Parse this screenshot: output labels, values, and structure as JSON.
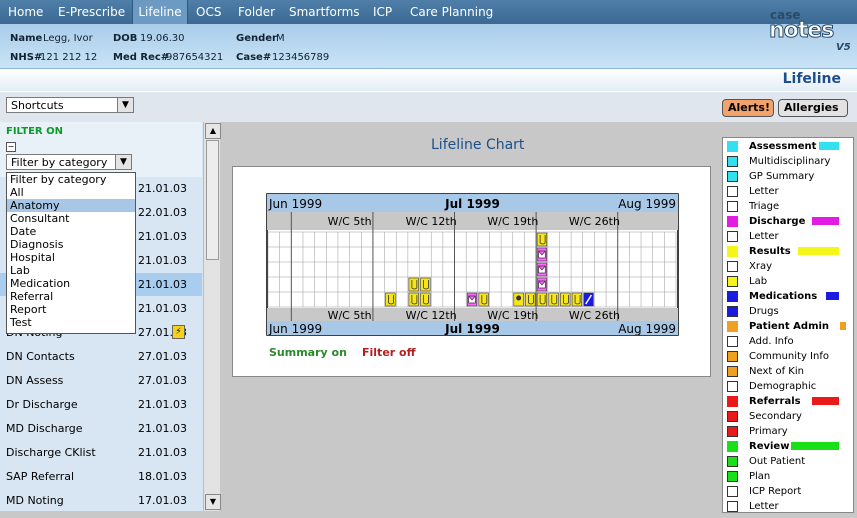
{
  "menu": {
    "items": [
      {
        "label": "Home",
        "active": false
      },
      {
        "label": "E-Prescribe",
        "active": false
      },
      {
        "label": "Lifeline",
        "active": true
      },
      {
        "label": "OCS",
        "active": false
      },
      {
        "label": "Folder",
        "active": false
      },
      {
        "label": "Smartforms",
        "active": false
      },
      {
        "label": "ICP",
        "active": false
      },
      {
        "label": "Care Planning",
        "active": false
      }
    ]
  },
  "patient": {
    "name_label": "Name",
    "name": "Legg, Ivor",
    "dob_label": "DOB",
    "dob": "19.06.30",
    "gender_label": "Gender",
    "gender": "M",
    "nhs_label": "NHS#",
    "nhs": "121 212 12",
    "medrec_label": "Med Rec#",
    "medrec": "987654321",
    "case_label": "Case#",
    "case": "123456789"
  },
  "logo": {
    "top": "case",
    "bottom": "notes",
    "version": "V5"
  },
  "page_title": "Lifeline",
  "toolbar": {
    "shortcuts_value": "Shortcuts",
    "alerts_label": "Alerts!",
    "allergies_label": "Allergies"
  },
  "sidebar": {
    "filter_on_label": "FILTER ON",
    "collapse_glyph": "−",
    "filter_select_value": "Filter by category",
    "dropdown_options": [
      "Filter by category",
      "All",
      "Anatomy",
      "Consultant",
      "Date",
      "Diagnosis",
      "Hospital",
      "Lab",
      "Medication",
      "Referral",
      "Report",
      "Test"
    ],
    "selected_option": "Anatomy",
    "items": [
      {
        "label": "",
        "date": "21.01.03"
      },
      {
        "label": "",
        "date": "22.01.03"
      },
      {
        "label": "",
        "date": "21.01.03"
      },
      {
        "label": "",
        "date": "21.01.03"
      },
      {
        "label": "",
        "date": "21.01.03"
      },
      {
        "label": "",
        "date": "21.01.03"
      },
      {
        "label": "DN Noting",
        "date": "27.01.03"
      },
      {
        "label": "DN Contacts",
        "date": "27.01.03"
      },
      {
        "label": "DN Assess",
        "date": "27.01.03"
      },
      {
        "label": "Dr Discharge",
        "date": "21.01.03"
      },
      {
        "label": "MD Discharge",
        "date": "21.01.03"
      },
      {
        "label": "Discharge CKlist",
        "date": "21.01.03"
      },
      {
        "label": "SAP Referral",
        "date": "18.01.03"
      },
      {
        "label": "MD Noting",
        "date": "17.01.03"
      }
    ]
  },
  "chart": {
    "title": "Lifeline Chart",
    "months": [
      "Jun 1999",
      "Jul 1999",
      "Aug 1999"
    ],
    "weeks": [
      "W/C 5th",
      "W/C 12th",
      "W/C 19th",
      "W/C 26th"
    ],
    "summary_label": "Summary on",
    "filter_label": "Filter off"
  },
  "colors": {
    "summary": "#2a8a2a",
    "filter": "#b02020",
    "accent": "#1d4f8c",
    "alerts_bg": "#f2a36a"
  },
  "chart_data": {
    "type": "table",
    "events": [
      {
        "day": 10,
        "row": 4,
        "icon": "lab-icon"
      },
      {
        "day": 12,
        "row": 3,
        "icon": "lab-icon"
      },
      {
        "day": 12,
        "row": 4,
        "icon": "lab-icon"
      },
      {
        "day": 13,
        "row": 3,
        "icon": "lab-icon"
      },
      {
        "day": 13,
        "row": 4,
        "icon": "lab-icon"
      },
      {
        "day": 17,
        "row": 4,
        "icon": "letter-icon"
      },
      {
        "day": 18,
        "row": 4,
        "icon": "lab-icon"
      },
      {
        "day": 21,
        "row": 4,
        "icon": "xray-icon"
      },
      {
        "day": 22,
        "row": 4,
        "icon": "lab-icon"
      },
      {
        "day": 23,
        "row": 0,
        "icon": "lab-icon"
      },
      {
        "day": 23,
        "row": 1,
        "icon": "letter-icon"
      },
      {
        "day": 23,
        "row": 2,
        "icon": "letter-icon"
      },
      {
        "day": 23,
        "row": 3,
        "icon": "letter-icon"
      },
      {
        "day": 23,
        "row": 4,
        "icon": "lab-icon"
      },
      {
        "day": 24,
        "row": 4,
        "icon": "lab-icon"
      },
      {
        "day": 25,
        "row": 4,
        "icon": "lab-icon"
      },
      {
        "day": 26,
        "row": 4,
        "icon": "lab-icon"
      },
      {
        "day": 27,
        "row": 4,
        "icon": "drugs-icon"
      }
    ]
  },
  "legend": [
    {
      "kind": "head",
      "label": "Assessment",
      "color": "#33e0f0"
    },
    {
      "kind": "item",
      "label": "Multidisciplinary",
      "icon": "md-icon"
    },
    {
      "kind": "item",
      "label": "GP Summary",
      "icon": "gp-icon"
    },
    {
      "kind": "item",
      "label": "Letter",
      "icon": "letter-icon"
    },
    {
      "kind": "item",
      "label": "Triage",
      "icon": "triage-icon"
    },
    {
      "kind": "head",
      "label": "Discharge",
      "color": "#e31ce3"
    },
    {
      "kind": "item",
      "label": "Letter",
      "icon": "letter-icon"
    },
    {
      "kind": "head",
      "label": "Results",
      "color": "#f5f51a"
    },
    {
      "kind": "item",
      "label": "Xray",
      "icon": "xray-icon"
    },
    {
      "kind": "item",
      "label": "Lab",
      "icon": "lab-icon"
    },
    {
      "kind": "head",
      "label": "Medications",
      "color": "#1a1ae0"
    },
    {
      "kind": "item",
      "label": "Drugs",
      "icon": "drugs-icon"
    },
    {
      "kind": "head",
      "label": "Patient Admin",
      "color": "#f0a020"
    },
    {
      "kind": "item",
      "label": "Add. Info",
      "icon": "addinfo-icon"
    },
    {
      "kind": "item",
      "label": "Community Info",
      "icon": "community-icon"
    },
    {
      "kind": "item",
      "label": "Next of Kin",
      "icon": "nok-icon"
    },
    {
      "kind": "item",
      "label": "Demographic",
      "icon": "demographic-icon"
    },
    {
      "kind": "head",
      "label": "Referrals",
      "color": "#e81a1a"
    },
    {
      "kind": "item",
      "label": "Secondary",
      "icon": "secondary-icon"
    },
    {
      "kind": "item",
      "label": "Primary",
      "icon": "primary-icon"
    },
    {
      "kind": "head",
      "label": "Review",
      "color": "#1ae01a"
    },
    {
      "kind": "item",
      "label": "Out Patient",
      "icon": "outpatient-icon"
    },
    {
      "kind": "item",
      "label": "Plan",
      "icon": "plan-icon"
    },
    {
      "kind": "item",
      "label": "ICP Report",
      "icon": "icpreport-icon"
    },
    {
      "kind": "item",
      "label": "Letter",
      "icon": "letter-icon"
    }
  ]
}
